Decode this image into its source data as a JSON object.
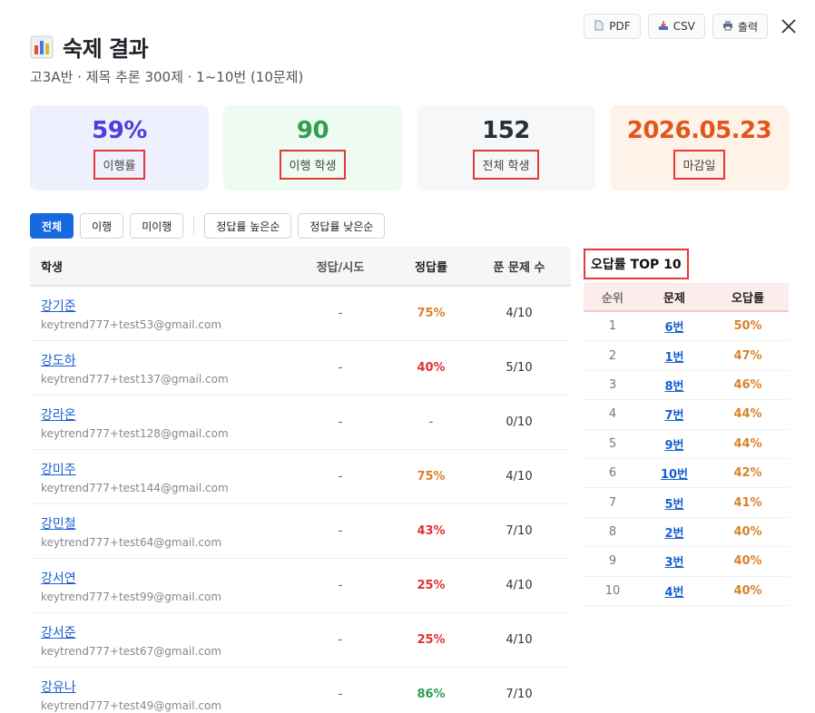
{
  "header": {
    "title": "숙제 결과",
    "subtitle": "고3A반 · 제목 추론 300제 · 1~10번 (10문제)",
    "pdf_label": "PDF",
    "csv_label": "CSV",
    "print_label": "출력"
  },
  "stats": [
    {
      "value": "59%",
      "label": "이행률",
      "color": "#4a3fdc",
      "bg": "#eef1fd"
    },
    {
      "value": "90",
      "label": "이행 학생",
      "color": "#2e9e4f",
      "bg": "#edfbf2"
    },
    {
      "value": "152",
      "label": "전체 학생",
      "color": "#2a2f36",
      "bg": "#f6f7f8"
    },
    {
      "value": "2026.05.23",
      "label": "마감일",
      "color": "#e2561b",
      "bg": "#fff2e9"
    }
  ],
  "filters": {
    "all": "전체",
    "done": "이행",
    "not_done": "미이행",
    "sort_high": "정답률 높은순",
    "sort_low": "정답률 낮은순"
  },
  "table": {
    "columns": {
      "student": "학생",
      "correct": "정답/시도",
      "rate": "정답률",
      "solved": "푼 문제 수"
    },
    "rows": [
      {
        "name": "강기준",
        "email": "keytrend777+test53@gmail.com",
        "correct": "-",
        "rate": "75%",
        "rate_color": "orange",
        "solved": "4/10"
      },
      {
        "name": "강도하",
        "email": "keytrend777+test137@gmail.com",
        "correct": "-",
        "rate": "40%",
        "rate_color": "red",
        "solved": "5/10"
      },
      {
        "name": "강라온",
        "email": "keytrend777+test128@gmail.com",
        "correct": "-",
        "rate": "-",
        "rate_color": "none",
        "solved": "0/10"
      },
      {
        "name": "강미주",
        "email": "keytrend777+test144@gmail.com",
        "correct": "-",
        "rate": "75%",
        "rate_color": "orange",
        "solved": "4/10"
      },
      {
        "name": "강민철",
        "email": "keytrend777+test64@gmail.com",
        "correct": "-",
        "rate": "43%",
        "rate_color": "red",
        "solved": "7/10"
      },
      {
        "name": "강서연",
        "email": "keytrend777+test99@gmail.com",
        "correct": "-",
        "rate": "25%",
        "rate_color": "red",
        "solved": "4/10"
      },
      {
        "name": "강서준",
        "email": "keytrend777+test67@gmail.com",
        "correct": "-",
        "rate": "25%",
        "rate_color": "red",
        "solved": "4/10"
      },
      {
        "name": "강유나",
        "email": "keytrend777+test49@gmail.com",
        "correct": "-",
        "rate": "86%",
        "rate_color": "green",
        "solved": "7/10"
      }
    ]
  },
  "top10": {
    "title": "오답률 TOP 10",
    "columns": {
      "rank": "순위",
      "question": "문제",
      "rate": "오답률"
    },
    "rows": [
      {
        "rank": "1",
        "question": "6번",
        "rate": "50%"
      },
      {
        "rank": "2",
        "question": "1번",
        "rate": "47%"
      },
      {
        "rank": "3",
        "question": "8번",
        "rate": "46%"
      },
      {
        "rank": "4",
        "question": "7번",
        "rate": "44%"
      },
      {
        "rank": "5",
        "question": "9번",
        "rate": "44%"
      },
      {
        "rank": "6",
        "question": "10번",
        "rate": "42%"
      },
      {
        "rank": "7",
        "question": "5번",
        "rate": "41%"
      },
      {
        "rank": "8",
        "question": "2번",
        "rate": "40%"
      },
      {
        "rank": "9",
        "question": "3번",
        "rate": "40%"
      },
      {
        "rank": "10",
        "question": "4번",
        "rate": "40%"
      }
    ]
  }
}
